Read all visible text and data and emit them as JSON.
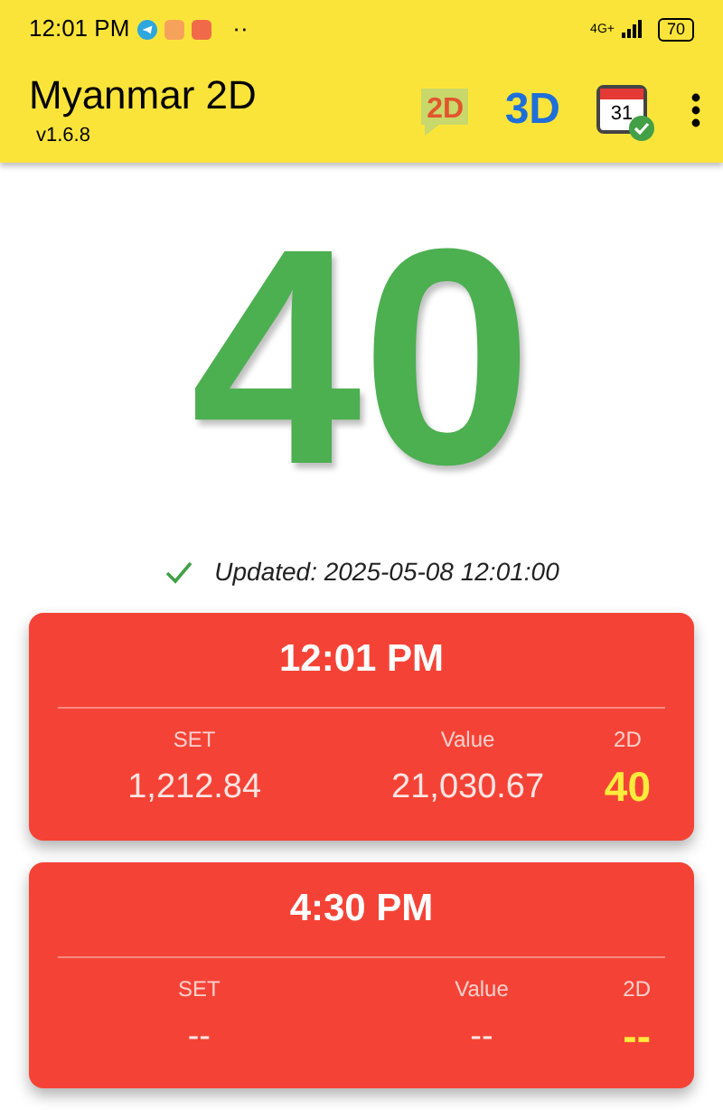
{
  "status_bar": {
    "time": "12:01 PM",
    "more": "··",
    "network": "4G+",
    "battery": "70"
  },
  "app_bar": {
    "title": "Myanmar 2D",
    "version": "v1.6.8",
    "icon_2d": "2D",
    "icon_3d": "3D",
    "calendar_day": "31"
  },
  "result": {
    "number": "40",
    "updated": "Updated: 2025-05-08 12:01:00"
  },
  "sessions": [
    {
      "time": "12:01 PM",
      "set_label": "SET",
      "set": "1,212.84",
      "value_label": "Value",
      "value": "21,030.67",
      "twod_label": "2D",
      "twod": "40"
    },
    {
      "time": "4:30 PM",
      "set_label": "SET",
      "set": "--",
      "value_label": "Value",
      "value": "--",
      "twod_label": "2D",
      "twod": "--"
    }
  ]
}
